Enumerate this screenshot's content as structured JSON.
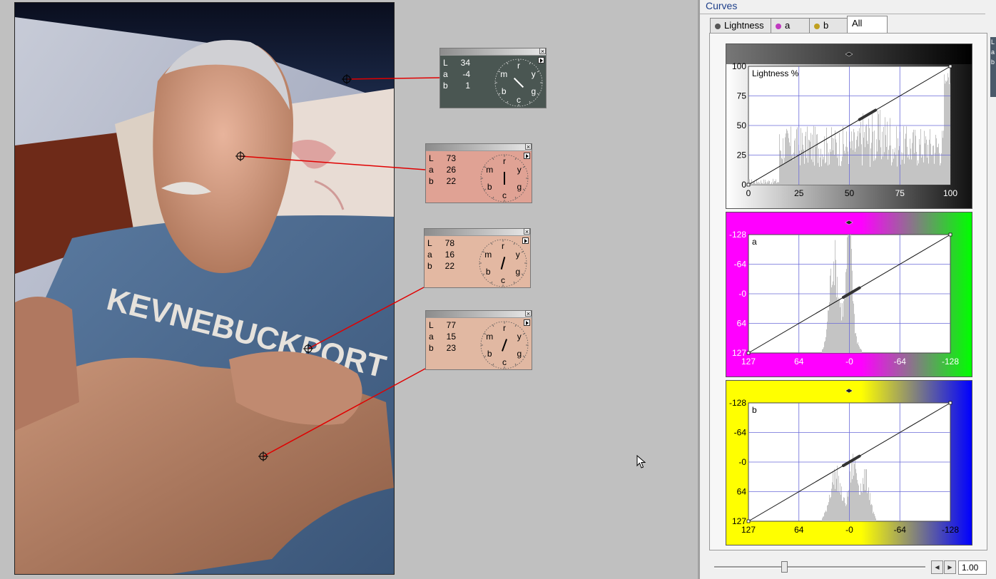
{
  "photo": {
    "shirt_text": "KEVNEBUCKPORT"
  },
  "readouts": [
    {
      "id": "r1",
      "L": "34",
      "a": "-4",
      "b": "1",
      "bg": "#4a5652",
      "dark": true,
      "hand_deg": 135
    },
    {
      "id": "r2",
      "L": "73",
      "a": "26",
      "b": "22",
      "bg": "#e0a294",
      "dark": false,
      "hand_deg": 0
    },
    {
      "id": "r3",
      "L": "78",
      "a": "16",
      "b": "22",
      "bg": "#e3b8a2",
      "dark": false,
      "hand_deg": 15
    },
    {
      "id": "r4",
      "L": "77",
      "a": "15",
      "b": "23",
      "bg": "#e1b8a2",
      "dark": false,
      "hand_deg": 20
    }
  ],
  "dial_letters": [
    "r",
    "y",
    "g",
    "c",
    "b",
    "m"
  ],
  "panel": {
    "title": "Curves",
    "tabs": [
      {
        "label": "Lightness",
        "icon_color": "#555555",
        "active": false
      },
      {
        "label": "a",
        "icon_color": "#c03ac0",
        "active": false
      },
      {
        "label": "b",
        "icon_color": "#c0a020",
        "active": false
      },
      {
        "label": "All",
        "icon_color": "",
        "active": true
      }
    ],
    "side_letters": [
      "L",
      "a",
      "b"
    ],
    "zoom_value": "1.00",
    "slider_value": 0.33
  },
  "chart_data": [
    {
      "type": "line",
      "title": "Lightness %",
      "x_ticks": [
        "0",
        "25",
        "50",
        "75",
        "100"
      ],
      "y_ticks": [
        "100",
        "75",
        "50",
        "25",
        "0"
      ],
      "xlim": [
        0,
        100
      ],
      "ylim": [
        0,
        100
      ],
      "series": [
        {
          "x": [
            0,
            100
          ],
          "y": [
            0,
            100
          ]
        }
      ],
      "colors": {
        "top_left": "#ffffff",
        "top_right": "#000000",
        "bottom_left": "#ffffff",
        "bottom_right": "#111111"
      }
    },
    {
      "type": "line",
      "title": "a",
      "x_ticks": [
        "127",
        "64",
        "-0",
        "-64",
        "-128"
      ],
      "y_ticks": [
        "-128",
        "-64",
        "-0",
        "64",
        "127"
      ],
      "xlim": [
        127,
        -128
      ],
      "ylim": [
        127,
        -128
      ],
      "series": [
        {
          "x": [
            127,
            -128
          ],
          "y": [
            127,
            -128
          ]
        }
      ],
      "colors": {
        "left": "#ff00ff",
        "right": "#00ff00"
      }
    },
    {
      "type": "line",
      "title": "b",
      "x_ticks": [
        "127",
        "64",
        "-0",
        "-64",
        "-128"
      ],
      "y_ticks": [
        "-128",
        "-64",
        "-0",
        "64",
        "127"
      ],
      "xlim": [
        127,
        -128
      ],
      "ylim": [
        127,
        -128
      ],
      "series": [
        {
          "x": [
            127,
            -128
          ],
          "y": [
            127,
            -128
          ]
        }
      ],
      "colors": {
        "left": "#ffff00",
        "right": "#0000ff"
      }
    }
  ]
}
